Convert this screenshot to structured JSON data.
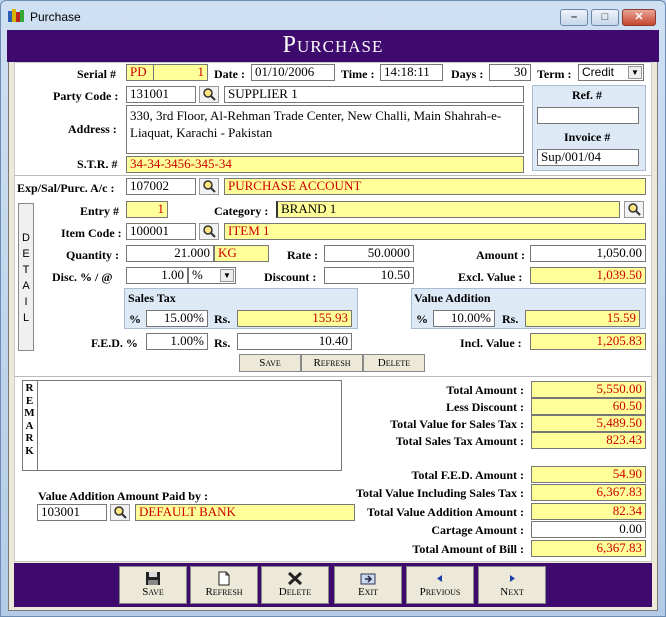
{
  "window": {
    "title": "Purchase",
    "min": "–",
    "max": "□",
    "close": "✕"
  },
  "banner": "Purchase",
  "header": {
    "serial_label": "Serial #",
    "serial_prefix": "PD",
    "serial_no": "1",
    "date_label": "Date :",
    "date": "01/10/2006",
    "time_label": "Time :",
    "time": "14:18:11",
    "days_label": "Days :",
    "days": "30",
    "term_label": "Term :",
    "term": "Credit",
    "party_label": "Party Code :",
    "party_code": "131001",
    "party_name": "SUPPLIER 1",
    "address_label": "Address :",
    "address": "330, 3rd Floor, Al-Rehman Trade Center, New Challi, Main Shahrah-e-Liaquat, Karachi - Pakistan",
    "str_label": "S.T.R. #",
    "str": "34-34-3456-345-34",
    "ref_label": "Ref. #",
    "ref": "",
    "invoice_label": "Invoice #",
    "invoice": "Sup/001/04",
    "account_label": "Exp/Sal/Purc. A/c :",
    "account_code": "107002",
    "account_name": "PURCHASE ACCOUNT"
  },
  "detail": {
    "strip": [
      "D",
      "E",
      "T",
      "A",
      "I",
      "L"
    ],
    "entry_label": "Entry #",
    "entry": "1",
    "category_label": "Category :",
    "category": "BRAND 1",
    "item_label": "Item Code :",
    "item_code": "100001",
    "item_name": "ITEM 1",
    "qty_label": "Quantity :",
    "qty": "21.000",
    "unit": "KG",
    "rate_label": "Rate :",
    "rate": "50.0000",
    "amount_label": "Amount :",
    "amount": "1,050.00",
    "disc_label": "Disc. % / @",
    "disc": "1.00",
    "disc_type": "%",
    "discount_label": "Discount :",
    "discount": "10.50",
    "excl_label": "Excl. Value :",
    "excl": "1,039.50",
    "salestax_title": "Sales Tax",
    "st_pct_label": "%",
    "st_pct": "15.00%",
    "st_rs_label": "Rs.",
    "st_rs": "155.93",
    "va_title": "Value Addition",
    "va_pct_label": "%",
    "va_pct": "10.00%",
    "va_rs_label": "Rs.",
    "va_rs": "15.59",
    "fed_label": "F.E.D. %",
    "fed_pct": "1.00%",
    "fed_rs_label": "Rs.",
    "fed_rs": "10.40",
    "incl_label": "Incl. Value :",
    "incl": "1,205.83",
    "save": "Save",
    "refresh": "Refresh",
    "delete": "Delete"
  },
  "remark": {
    "strip": [
      "R",
      "E",
      "M",
      "A",
      "R",
      "K"
    ],
    "text": ""
  },
  "totals": [
    {
      "label": "Total Amount :",
      "value": "5,550.00"
    },
    {
      "label": "Less Discount :",
      "value": "60.50"
    },
    {
      "label": "Total Value for Sales Tax :",
      "value": "5,489.50"
    },
    {
      "label": "Total Sales Tax Amount :",
      "value": "823.43"
    },
    {
      "label": "Total F.E.D. Amount :",
      "value": "54.90"
    },
    {
      "label": "Total Value Including Sales Tax :",
      "value": "6,367.83"
    },
    {
      "label": "Total Value Addition Amount :",
      "value": "82.34"
    },
    {
      "label": "Cartage Amount :",
      "value": "0.00"
    },
    {
      "label": "Total Amount of Bill :",
      "value": "6,367.83"
    }
  ],
  "va_paid": {
    "label": "Value Addition Amount Paid by :",
    "code": "103001",
    "name": "DEFAULT BANK"
  },
  "buttons": {
    "save": "Save",
    "refresh": "Refresh",
    "delete": "Delete",
    "exit": "Exit",
    "previous": "Previous",
    "next": "Next"
  },
  "icons": {
    "search": "magnifier-icon",
    "save": "floppy-icon",
    "refresh": "page-icon",
    "delete": "x-icon",
    "exit": "exit-icon",
    "previous": "triangle-left-icon",
    "next": "triangle-right-icon"
  }
}
